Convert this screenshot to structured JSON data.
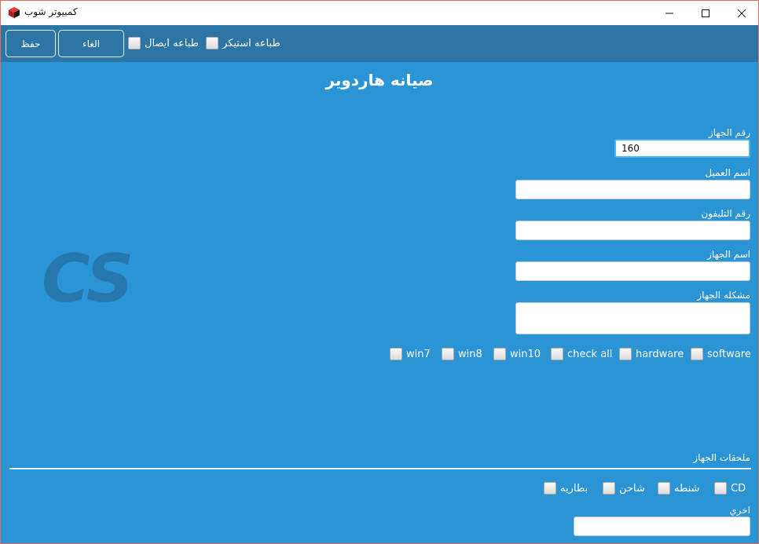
{
  "window": {
    "title": "كمبيوتر شوب"
  },
  "toolbar": {
    "save_label": "حفظ",
    "cancel_label": "الغاء",
    "print_receipt_label": "طباعه ايصال",
    "print_sticker_label": "طباعه استيكر"
  },
  "form": {
    "heading": "صيانه هاردوير",
    "logo_text": "CS",
    "device_number": {
      "label": "رقم الجهاز",
      "value": "160"
    },
    "customer_name": {
      "label": "اسم العميل",
      "value": ""
    },
    "phone_number": {
      "label": "رقم التليفون",
      "value": ""
    },
    "device_name": {
      "label": "اسم الجهاز",
      "value": ""
    },
    "device_problem": {
      "label": "مشكله الجهاز",
      "value": ""
    },
    "options": [
      "win7",
      "win8",
      "win10",
      "check all",
      "hardware",
      "software"
    ]
  },
  "accessories": {
    "label": "ملحقات الجهاز",
    "items": [
      "بطاريه",
      "شاحن",
      "شنطه",
      "CD"
    ],
    "other": {
      "label": "اخري",
      "value": ""
    }
  },
  "colors": {
    "background": "#2b94d5",
    "toolbar": "#2d75a4",
    "logo": "#2577ad"
  }
}
